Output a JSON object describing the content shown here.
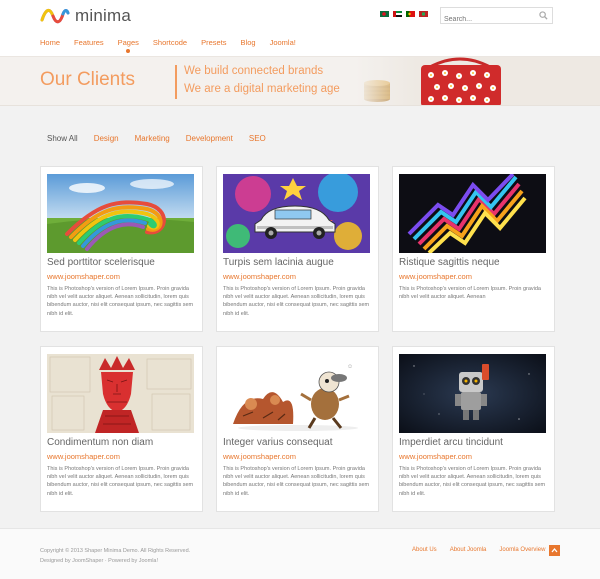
{
  "brand": {
    "name": "minima"
  },
  "search": {
    "placeholder": "Search..."
  },
  "languages": [
    "Bengali",
    "Arabic",
    "Portuguese",
    "Other"
  ],
  "nav": {
    "items": [
      {
        "label": "Home"
      },
      {
        "label": "Features"
      },
      {
        "label": "Pages",
        "active": true
      },
      {
        "label": "Shortcode"
      },
      {
        "label": "Presets"
      },
      {
        "label": "Blog"
      },
      {
        "label": "Joomla!"
      }
    ]
  },
  "banner": {
    "title": "Our Clients",
    "slogan1": "We build connected brands",
    "slogan2": "We are a digital marketing age"
  },
  "filters": [
    {
      "label": "Show All",
      "active": true
    },
    {
      "label": "Design"
    },
    {
      "label": "Marketing"
    },
    {
      "label": "Development"
    },
    {
      "label": "SEO"
    }
  ],
  "cards": [
    {
      "title": "Sed porttitor scelerisque",
      "link": "www.joomshaper.com",
      "desc": "This is Photoshop's version of Lorem Ipsum. Proin gravida nibh vel velit auctor aliquet. Aenean sollicitudin, lorem quis bibendum auctor, nisi elit consequat ipsum, nec sagittis sem nibh id elit.",
      "image": "rainbow-ribbons"
    },
    {
      "title": "Turpis sem lacinia augue",
      "link": "www.joomshaper.com",
      "desc": "This is Photoshop's version of Lorem Ipsum. Proin gravida nibh vel velit auctor aliquet. Aenean sollicitudin, lorem quis bibendum auctor, nisi elit consequat ipsum, nec sagittis sem nibh id elit.",
      "image": "colorful-car"
    },
    {
      "title": "Ristique sagittis neque",
      "link": "www.joomshaper.com",
      "desc": "This is Photoshop's version of Lorem Ipsum. Proin gravida nibh vel velit auctor aliquet. Aenean",
      "image": "neon-zigzag"
    },
    {
      "title": "Condimentum non diam",
      "link": "www.joomshaper.com",
      "desc": "This is Photoshop's version of Lorem Ipsum. Proin gravida nibh vel velit auctor aliquet. Aenean sollicitudin, lorem quis bibendum auctor, nisi elit consequat ipsum, nec sagittis sem nibh id elit.",
      "image": "red-king-portrait"
    },
    {
      "title": "Integer varius consequat",
      "link": "www.joomshaper.com",
      "desc": "This is Photoshop's version of Lorem Ipsum. Proin gravida nibh vel velit auctor aliquet. Aenean sollicitudin, lorem quis bibendum auctor, nisi elit consequat ipsum, nec sagittis sem nibh id elit.",
      "image": "cartoon-chase"
    },
    {
      "title": "Imperdiet arcu tincidunt",
      "link": "www.joomshaper.com",
      "desc": "This is Photoshop's version of Lorem Ipsum. Proin gravida nibh vel velit auctor aliquet. Aenean sollicitudin, lorem quis bibendum auctor, nisi elit consequat ipsum, nec sagittis sem nibh id elit.",
      "image": "space-robot"
    }
  ],
  "footer": {
    "copyright": "Copyright © 2013 Shaper Minima Demo. All Rights Reserved.",
    "credits": "Designed by JoomShaper · Powered by Joomla!",
    "links": [
      {
        "label": "About Us"
      },
      {
        "label": "About Joomla"
      },
      {
        "label": "Joomla Overview"
      }
    ]
  },
  "colors": {
    "accent": "#e8772e",
    "banner_text": "#f39c5f",
    "background": "#f2f2f2"
  }
}
